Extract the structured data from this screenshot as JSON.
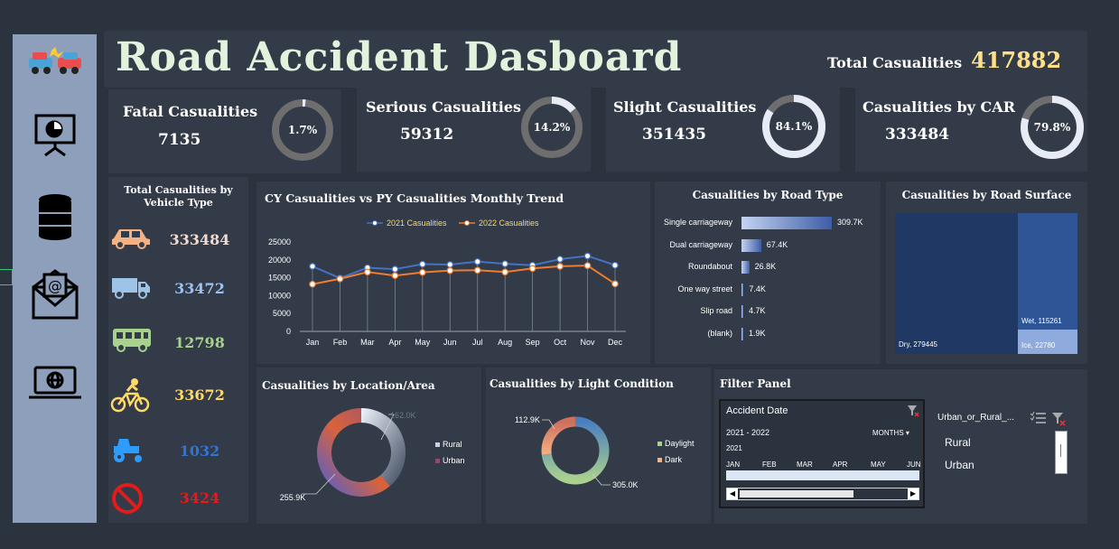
{
  "title": "Road Accident Dasboard",
  "total": {
    "label": "Total Casualities",
    "value": "417882"
  },
  "kpis": [
    {
      "label": "Fatal Casualities",
      "value": "7135",
      "pct_label": "1.7%",
      "pct": 1.7
    },
    {
      "label": "Serious Casualities",
      "value": "59312",
      "pct_label": "14.2%",
      "pct": 14.2
    },
    {
      "label": "Slight Casualities",
      "value": "351435",
      "pct_label": "84.1%",
      "pct": 84.1
    },
    {
      "label": "Casualities by CAR",
      "value": "333484",
      "pct_label": "79.8%",
      "pct": 79.8
    }
  ],
  "vehicle": {
    "title_line1": "Total Casualities by",
    "title_line2": "Vehicle Type",
    "items": [
      {
        "icon": "car-icon",
        "value": "333484",
        "color": "#f2d9d0"
      },
      {
        "icon": "van-icon",
        "value": "33472",
        "color": "#9ec3f0"
      },
      {
        "icon": "bus-icon",
        "value": "12798",
        "color": "#a9d18e"
      },
      {
        "icon": "bicycle-icon",
        "value": "33672",
        "color": "#ffd966"
      },
      {
        "icon": "tractor-icon",
        "value": "1032",
        "color": "#2e75d6"
      },
      {
        "icon": "prohibited-icon",
        "value": "3424",
        "color": "#e31b1b"
      }
    ]
  },
  "colors": {
    "cy": "#4472c4",
    "py": "#ed7d31",
    "bar_dark": "#3d5da6",
    "dry": "#1f3864",
    "wet": "#2f5597",
    "ice": "#8faadc",
    "rural": "#c9d2e3",
    "urban": "#8c4c6b"
  },
  "chart_data": [
    {
      "type": "line",
      "title": "CY Casualities vs PY Casualities Monthly Trend",
      "categories": [
        "Jan",
        "Feb",
        "Mar",
        "Apr",
        "May",
        "Jun",
        "Jul",
        "Aug",
        "Sep",
        "Oct",
        "Nov",
        "Dec"
      ],
      "yticks": [
        "0",
        "5000",
        "10000",
        "15000",
        "20000",
        "25000"
      ],
      "ylim": [
        0,
        25000
      ],
      "series": [
        {
          "name": "2021 Casualities",
          "values": [
            18200,
            14900,
            17800,
            17400,
            18800,
            18700,
            19500,
            18900,
            18500,
            20200,
            21100,
            18500
          ]
        },
        {
          "name": "2022 Casualities",
          "values": [
            13200,
            14700,
            16600,
            15600,
            16500,
            17000,
            17100,
            16600,
            17600,
            18200,
            18400,
            13300
          ]
        }
      ]
    },
    {
      "type": "bar",
      "title": "Casualities by Road Type",
      "categories": [
        "Single carriageway",
        "Dual carriageway",
        "Roundabout",
        "One way street",
        "Slip road",
        "(blank)"
      ],
      "values": [
        309.7,
        67.4,
        26.8,
        7.4,
        4.7,
        1.9
      ],
      "labels": [
        "309.7K",
        "67.4K",
        "26.8K",
        "7.4K",
        "4.7K",
        "1.9K"
      ]
    },
    {
      "type": "heatmap",
      "title": "Casualities by Road Surface",
      "cells": [
        {
          "label": "Dry, 279445",
          "value": 279445
        },
        {
          "label": "Wet, 115261",
          "value": 115261
        },
        {
          "label": "Ice, 22780",
          "value": 22780
        }
      ]
    },
    {
      "type": "pie",
      "title": "Casualities by Location/Area",
      "labels": [
        "Rural",
        "Urban"
      ],
      "values": [
        162.0,
        255.9
      ],
      "value_labels": [
        "162.0K",
        "255.9K"
      ]
    },
    {
      "type": "pie",
      "title": "Casualities by Light Condition",
      "labels": [
        "Daylight",
        "Dark"
      ],
      "values": [
        305.0,
        112.9
      ],
      "value_labels": [
        "305.0K",
        "112.9K"
      ]
    }
  ],
  "filter": {
    "title": "Filter Panel",
    "date_title": "Accident Date",
    "range": "2021 - 2022",
    "unit": "MONTHS",
    "year": "2021",
    "months": [
      "JAN",
      "FEB",
      "MAR",
      "APR",
      "MAY",
      "JUN"
    ],
    "urban_title": "Urban_or_Rural_...",
    "urban_items": [
      "Rural",
      "Urban"
    ]
  }
}
